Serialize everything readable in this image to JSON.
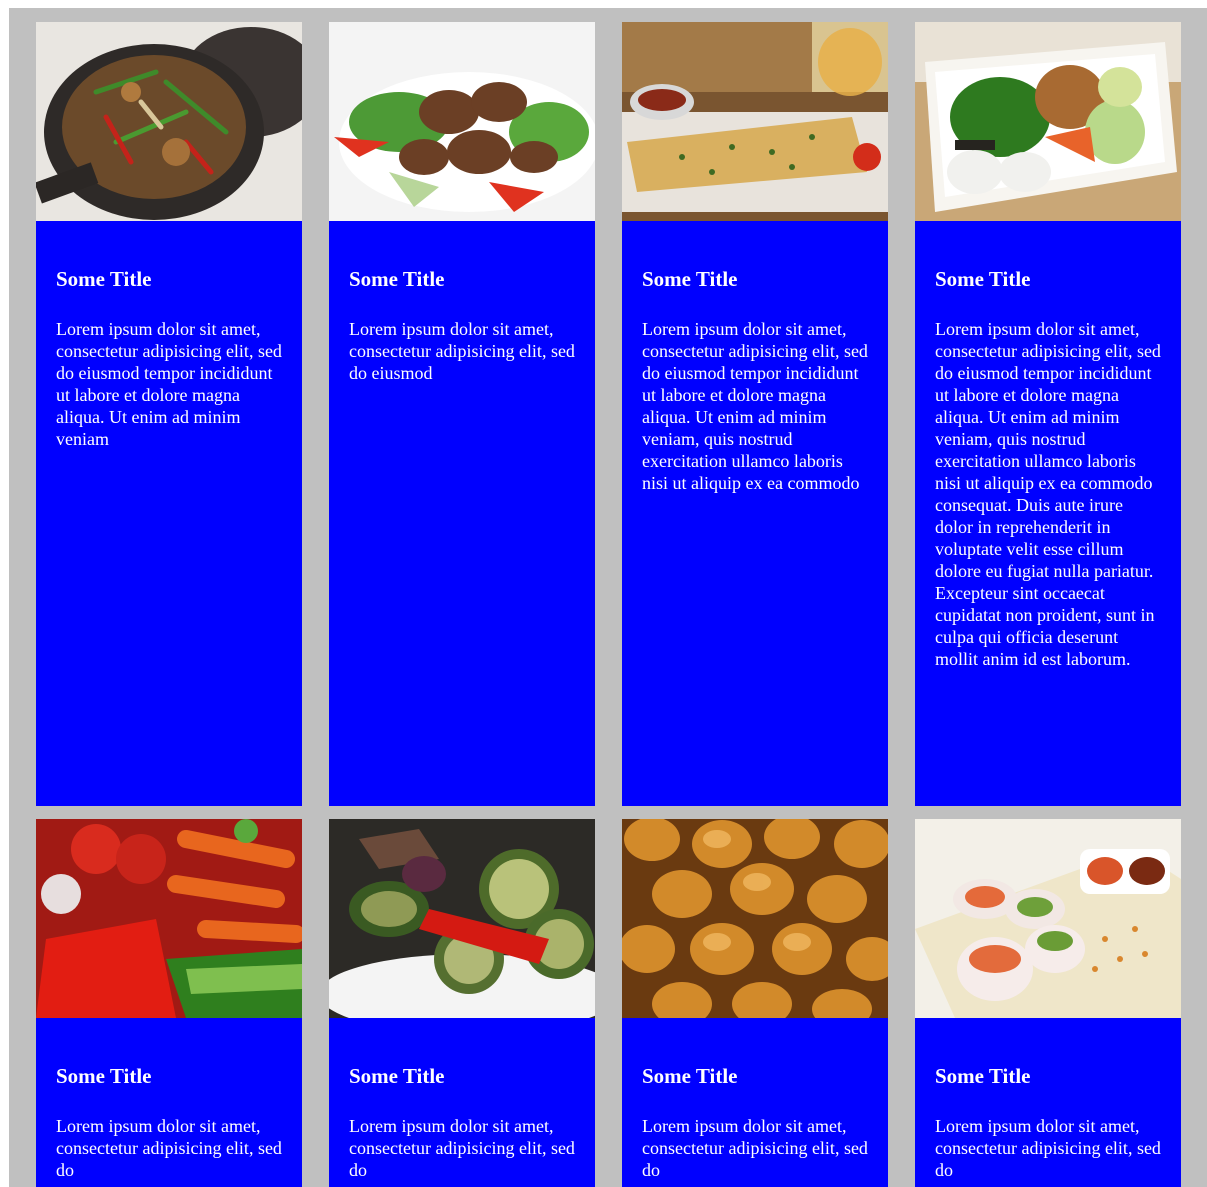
{
  "colors": {
    "frame_bg": "#c0c0c0",
    "card_body": "#0000ff",
    "card_text": "#ffffff"
  },
  "cards": [
    {
      "title": "Some Title",
      "text": "Lorem ipsum dolor sit amet, consectetur adipisicing elit, sed do eiusmod tempor incididunt ut labore et dolore magna aliqua. Ut enim ad minim veniam",
      "image": "stir-fry-pot-photo"
    },
    {
      "title": "Some Title",
      "text": "Lorem ipsum dolor sit amet, consectetur adipisicing elit, sed do eiusmod",
      "image": "beef-salad-photo"
    },
    {
      "title": "Some Title",
      "text": "Lorem ipsum dolor sit amet, consectetur adipisicing elit, sed do eiusmod tempor incididunt ut labore et dolore magna aliqua. Ut enim ad minim veniam, quis nostrud exercitation ullamco laboris nisi ut aliquip ex ea commodo",
      "image": "garlic-bread-photo"
    },
    {
      "title": "Some Title",
      "text": "Lorem ipsum dolor sit amet, consectetur adipisicing elit, sed do eiusmod tempor incididunt ut labore et dolore magna aliqua. Ut enim ad minim veniam, quis nostrud exercitation ullamco laboris nisi ut aliquip ex ea commodo consequat. Duis aute irure dolor in reprehenderit in voluptate velit esse cillum dolore eu fugiat nulla pariatur. Excepteur sint occaecat cupidatat non proident, sunt in culpa qui officia deserunt mollit anim id est laborum.",
      "image": "bento-box-photo"
    },
    {
      "title": "Some Title",
      "text": "Lorem ipsum dolor sit amet, consectetur adipisicing elit, sed do",
      "image": "vegetables-photo"
    },
    {
      "title": "Some Title",
      "text": "Lorem ipsum dolor sit amet, consectetur adipisicing elit, sed do",
      "image": "grilled-vegetables-photo"
    },
    {
      "title": "Some Title",
      "text": "Lorem ipsum dolor sit amet, consectetur adipisicing elit, sed do",
      "image": "bread-rolls-photo"
    },
    {
      "title": "Some Title",
      "text": "Lorem ipsum dolor sit amet, consectetur adipisicing elit, sed do",
      "image": "sushi-rolls-photo"
    }
  ]
}
